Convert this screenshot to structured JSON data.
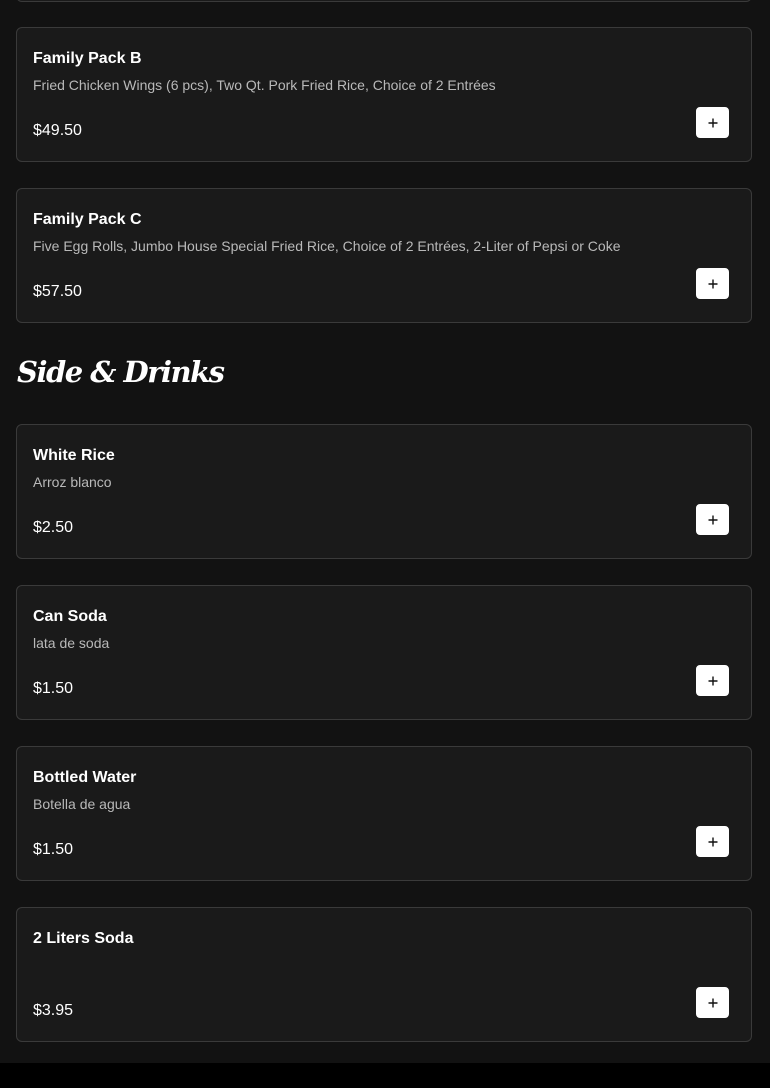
{
  "menu": {
    "family_packs": [
      {
        "name": "Family Pack B",
        "description": "Fried Chicken Wings (6 pcs), Two Qt. Pork Fried Rice, Choice of 2 Entrées",
        "price": "$49.50"
      },
      {
        "name": "Family Pack C",
        "description": "Five Egg Rolls, Jumbo House Special Fried Rice, Choice of 2 Entrées, 2-Liter of Pepsi or Coke",
        "price": "$57.50"
      }
    ],
    "sides_section": {
      "title": "Side & Drinks",
      "items": [
        {
          "name": "White Rice",
          "description": "Arroz blanco",
          "price": "$2.50"
        },
        {
          "name": "Can Soda",
          "description": "lata de soda",
          "price": "$1.50"
        },
        {
          "name": "Bottled Water",
          "description": "Botella de agua",
          "price": "$1.50"
        },
        {
          "name": "2 Liters Soda",
          "description": "",
          "price": "$3.95"
        }
      ]
    }
  },
  "icons": {
    "add": "plus-icon"
  },
  "colors": {
    "background": "#121212",
    "card_background": "#1a1a1a",
    "card_border": "#3a3a3a",
    "text_primary": "#ffffff",
    "text_secondary": "#b9b9b9",
    "button_background": "#ffffff"
  }
}
